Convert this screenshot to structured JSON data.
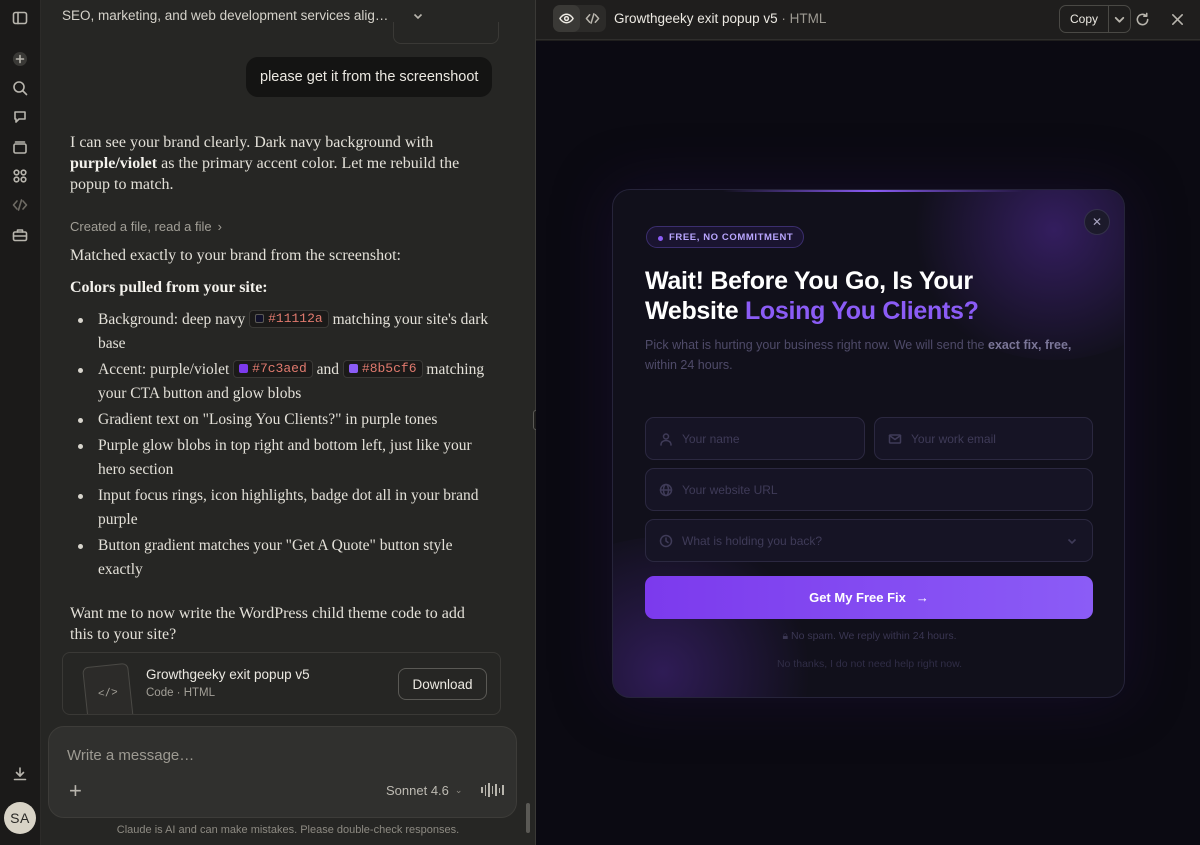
{
  "rail": {
    "avatar_initials": "SA"
  },
  "chat": {
    "title": "SEO, marketing, and web development services alig…",
    "user_message": "please get it from the screenshoot",
    "intro": {
      "part1": "I can see your brand clearly. Dark navy background with ",
      "bold": "purple/violet",
      "part2": " as the primary accent color. Let me rebuild the popup to match."
    },
    "files_line": "Created a file, read a file",
    "matched_line": "Matched exactly to your brand from the screenshot:",
    "colors_heading": "Colors pulled from your site:",
    "bullets": {
      "b1_pre": "Background: deep navy ",
      "b1_code": "#11112a",
      "b1_post": " matching your site's dark base",
      "b2_pre": "Accent: purple/violet ",
      "b2_code1": "#7c3aed",
      "b2_mid": " and ",
      "b2_code2": "#8b5cf6",
      "b2_post": " matching your CTA button and glow blobs",
      "b3": "Gradient text on \"Losing You Clients?\" in purple tones",
      "b4": "Purple glow blobs in top right and bottom left, just like your hero section",
      "b5": "Input focus rings, icon highlights, badge dot all in your brand purple",
      "b6": "Button gradient matches your \"Get A Quote\" button style exactly"
    },
    "closing": "Want me to now write the WordPress child theme code to add this to your site?",
    "file_card": {
      "name": "Growthgeeky exit popup v5",
      "meta": "Code · HTML",
      "thumb": "</>",
      "download": "Download"
    },
    "composer": {
      "placeholder": "Write a message…",
      "model": "Sonnet 4.6"
    },
    "disclaimer": "Claude is AI and can make mistakes. Please double-check responses."
  },
  "artifact": {
    "title": "Growthgeeky exit popup v5",
    "kind": "HTML",
    "copy_label": "Copy",
    "popup": {
      "badge": "FREE, NO COMMITMENT",
      "headline_line1": "Wait! Before You Go, Is Your",
      "headline_line2_pre": "Website ",
      "headline_accent": "Losing You Clients?",
      "sub_pre": "Pick what is hurting your business right now. We will send the ",
      "sub_bold": "exact fix, free,",
      "sub_post": " within 24 hours.",
      "name_placeholder": "Your name",
      "email_placeholder": "Your work email",
      "url_placeholder": "Your website URL",
      "select_placeholder": "What is holding you back?",
      "cta": "Get My Free Fix",
      "cta_arrow": "→",
      "spam_note": "No spam. We reply within 24 hours.",
      "no_thanks": "No thanks, I do not need help right now."
    }
  },
  "colors": {
    "navy": "#11112a",
    "purple": "#7c3aed",
    "violet": "#8b5cf6"
  }
}
